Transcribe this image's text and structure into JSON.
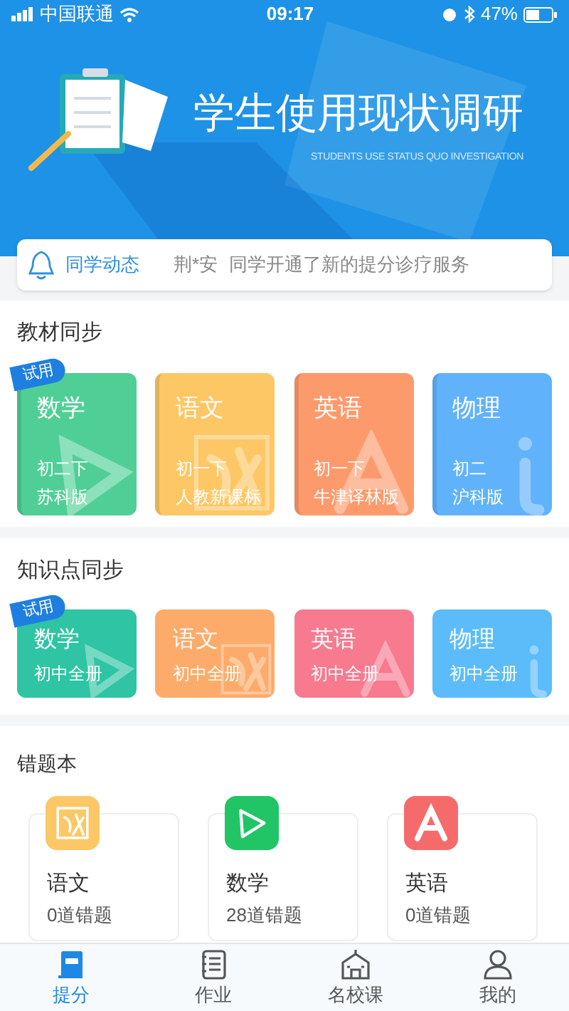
{
  "status_bar": {
    "carrier": "中国联通",
    "time": "09:17",
    "battery": "47%"
  },
  "banner": {
    "title": "学生使用现状调研",
    "subtitle": "STUDENTS USE STATUS QUO INVESTIGATION"
  },
  "notice": {
    "label": "同学动态",
    "name": "荆*安",
    "message": "同学开通了新的提分诊疗服务"
  },
  "textbook_sync": {
    "title": "教材同步",
    "books": [
      {
        "subject": "数学",
        "grade": "初二下",
        "edition": "苏科版",
        "badge": "试用",
        "color": "#4fcf96",
        "kind": "math"
      },
      {
        "subject": "语文",
        "grade": "初一下",
        "edition": "人教新课标",
        "color": "#fdc765",
        "kind": "chinese"
      },
      {
        "subject": "英语",
        "grade": "初一下",
        "edition": "牛津译林版",
        "color": "#fd9a6c",
        "kind": "english"
      },
      {
        "subject": "物理",
        "grade": "初二",
        "edition": "沪科版",
        "color": "#60b3fb",
        "kind": "physics"
      }
    ]
  },
  "knowledge_sync": {
    "title": "知识点同步",
    "books": [
      {
        "subject": "数学",
        "scope": "初中全册",
        "badge": "试用",
        "color": "#2ec4a4",
        "kind": "math"
      },
      {
        "subject": "语文",
        "scope": "初中全册",
        "color": "#fdab6a",
        "kind": "chinese"
      },
      {
        "subject": "英语",
        "scope": "初中全册",
        "color": "#f77a8f",
        "kind": "english"
      },
      {
        "subject": "物理",
        "scope": "初中全册",
        "color": "#5cbcfa",
        "kind": "physics"
      }
    ]
  },
  "mistake_book": {
    "title": "错题本",
    "items": [
      {
        "subject": "语文",
        "count": "0道错题",
        "color": "#fcc766",
        "kind": "chinese"
      },
      {
        "subject": "数学",
        "count": "28道错题",
        "color": "#21c566",
        "kind": "math"
      },
      {
        "subject": "英语",
        "count": "0道错题",
        "color": "#f56b6b",
        "kind": "english"
      }
    ]
  },
  "tabs": [
    {
      "label": "提分",
      "selected": true,
      "kind": "score"
    },
    {
      "label": "作业",
      "selected": false,
      "kind": "homework"
    },
    {
      "label": "名校课",
      "selected": false,
      "kind": "school"
    },
    {
      "label": "我的",
      "selected": false,
      "kind": "profile"
    }
  ]
}
